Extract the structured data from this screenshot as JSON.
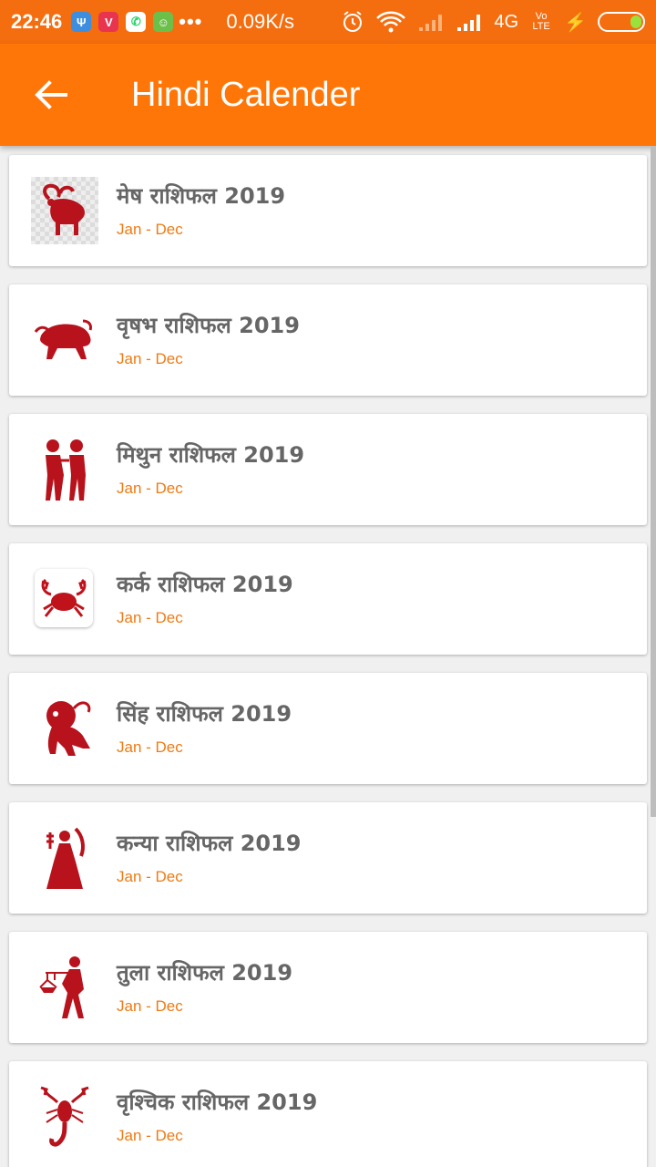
{
  "status_bar": {
    "time": "22:46",
    "speed": "0.09K/s",
    "network": "4G",
    "volte": "Vo LTE"
  },
  "app_bar": {
    "title": "Hindi Calender"
  },
  "colors": {
    "app_bar": "#ff7608",
    "status_bar": "#f46d0f",
    "subtitle": "#ef7a13",
    "icon_red": "#c0121b"
  },
  "items": [
    {
      "title": "मेष राशिफल 2019",
      "subtitle": "Jan - Dec",
      "icon": "aries-ram-icon"
    },
    {
      "title": "वृषभ राशिफल 2019",
      "subtitle": "Jan - Dec",
      "icon": "taurus-bull-icon"
    },
    {
      "title": "मिथुन राशिफल 2019",
      "subtitle": "Jan - Dec",
      "icon": "gemini-twins-icon"
    },
    {
      "title": "कर्क राशिफल 2019",
      "subtitle": "Jan - Dec",
      "icon": "cancer-crab-icon"
    },
    {
      "title": "सिंह राशिफल 2019",
      "subtitle": "Jan - Dec",
      "icon": "leo-lion-icon"
    },
    {
      "title": "कन्या राशिफल 2019",
      "subtitle": "Jan - Dec",
      "icon": "virgo-maiden-icon"
    },
    {
      "title": "तुला राशिफल 2019",
      "subtitle": "Jan - Dec",
      "icon": "libra-scales-icon"
    },
    {
      "title": "वृश्चिक राशिफल 2019",
      "subtitle": "Jan - Dec",
      "icon": "scorpio-scorpion-icon"
    }
  ]
}
